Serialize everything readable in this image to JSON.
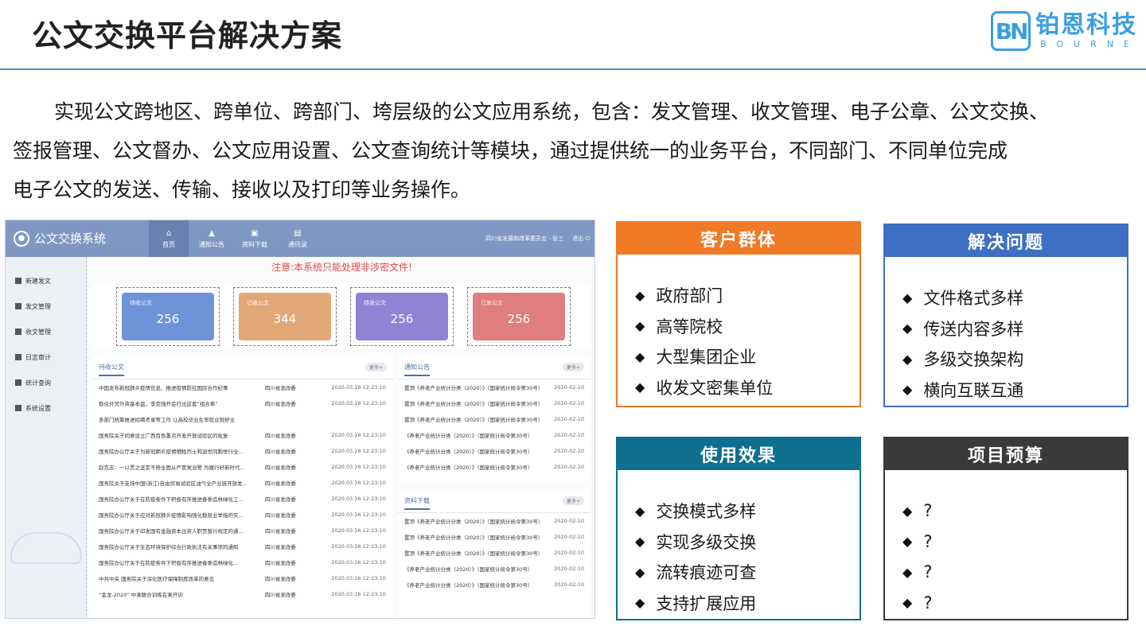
{
  "header": {
    "title": "公文交换平台解决方案",
    "logo_mark": "BN",
    "logo_cn": "铂恩科技",
    "logo_en": "BOURNE"
  },
  "intro": {
    "lines": [
      "实现公文跨地区、跨单位、跨部门、垮层级的公文应用系统，包含：发文管理、收文管理、电子公章、公文交换、",
      "签报管理、公文督办、公文应用设置、公文查询统计等模块，通过提供统一的业务平台，不同部门、不同单位完成",
      "电子公文的发送、传输、接收以及打印等业务操作。"
    ]
  },
  "mock": {
    "app_title": "公文交换系统",
    "nav": [
      {
        "label": "首页",
        "icon": "home-icon"
      },
      {
        "label": "通知公告",
        "icon": "bell-icon"
      },
      {
        "label": "资料下载",
        "icon": "download-icon"
      },
      {
        "label": "通讯录",
        "icon": "contacts-icon"
      }
    ],
    "user": "四川省发展和改革委员会 - 张三",
    "logout": "退出",
    "sidebar": [
      "新建发文",
      "发文管理",
      "收文管理",
      "日志审计",
      "统计查询",
      "系统设置"
    ],
    "notice": "注意:本系统只能处理非涉密文件!",
    "cards": [
      {
        "label": "待收公文",
        "value": "256",
        "color": "#6f93d8"
      },
      {
        "label": "已收公文",
        "value": "344",
        "color": "#e2a777"
      },
      {
        "label": "待发公文",
        "value": "256",
        "color": "#8f83d6"
      },
      {
        "label": "已发公文",
        "value": "256",
        "color": "#e07d7d"
      }
    ],
    "pending": {
      "title": "待收公文",
      "more": "更多+",
      "rows": [
        {
          "t": "中国发布新冠肺炎疫情信息、推进疫情防控国际合作纪事",
          "d": "四川省发改委",
          "tm": "2020.03.16 12:23:10"
        },
        {
          "t": "稳住外贸外资基本盘，李克强开会打出这套“组合拳”",
          "d": "四川省发改委",
          "tm": "2020.03.16 12:23:10"
        },
        {
          "t": "多部门统筹推进招聘考录等工作 让高校毕业生早就业就好业",
          "d": "",
          "tm": ""
        },
        {
          "t": "国务院关于同意设立广西百色重点开发开放试验区的批复",
          "d": "四川省发改委",
          "tm": "2020.03.16 12:23:10"
        },
        {
          "t": "国务院办公厅关于为新冠肺炎疫情牺牲烈士和逝世同胞举行全...",
          "d": "四川省发改委",
          "tm": "2020.03.16 12:23:10"
        },
        {
          "t": "赵克志：一以贯之坚定不移全面从严管党治警 为履行好新时代...",
          "d": "四川省发改委",
          "tm": "2020.03.16 12:23:10"
        },
        {
          "t": "国务院关于支持中国(浙江)自由贸易试验区油气全产业链开放发...",
          "d": "四川省发改委",
          "tm": "2020.03.16 12:23:10"
        },
        {
          "t": "国务院办公厅关于在防疫条件下积极有序推进春季造林绿化工...",
          "d": "四川省发改委",
          "tm": "2020.03.16 12:23:10"
        },
        {
          "t": "国务院办公厅关于应对新冠肺炎疫情影响强化稳就业举措的实...",
          "d": "四川省发改委",
          "tm": "2020.03.16 12:23:10"
        },
        {
          "t": "国务院办公厅关于印发国有金融资本出资人职责暂行规定的通...",
          "d": "四川省发改委",
          "tm": "2020.03.16 12:23:10"
        },
        {
          "t": "国务院办公厅关于生态环境保护综合行政执法有关事项的通知",
          "d": "四川省发改委",
          "tm": "2020.03.16 12:23:10"
        },
        {
          "t": "国务院办公厅关于在防疫条件下积极有序推进春季造林绿化...",
          "d": "四川省发改委",
          "tm": "2020.03.16 12:23:10"
        },
        {
          "t": "中共中央 国务院关于深化医疗保障制度改革的意见",
          "d": "四川省发改委",
          "tm": "2020.03.16 12:23:10"
        },
        {
          "t": "“金龙-2020” 中柬联合训练在柬开训",
          "d": "四川省发改委",
          "tm": "2020.03.16 12:23:10"
        }
      ]
    },
    "announce": {
      "title": "通知公告",
      "more": "更多+",
      "rows": [
        {
          "tag": "置顶",
          "t": "《养老产业统计分类（2020）》（国家统计局令第30号）",
          "tm": "2020-02-10"
        },
        {
          "tag": "置顶",
          "t": "《养老产业统计分类（2020）》（国家统计局令第30号）",
          "tm": "2020-02-10"
        },
        {
          "tag": "置顶",
          "t": "《养老产业统计分类（2020）》（国家统计局令第30号）",
          "tm": "2020-02-10"
        },
        {
          "tag": "",
          "t": "《养老产业统计分类（2020）》（国家统计局令第30号）",
          "tm": "2020-02-10"
        },
        {
          "tag": "",
          "t": "《养老产业统计分类（2020）》（国家统计局令第30号）",
          "tm": "2020-02-10"
        },
        {
          "tag": "",
          "t": "《养老产业统计分类（2020）》（国家统计局令第30号）",
          "tm": "2020-02-10"
        }
      ]
    },
    "downloads": {
      "title": "资料下载",
      "more": "更多+",
      "rows": [
        {
          "tag": "置顶",
          "t": "《养老产业统计分类（2020）》（国家统计局令第30号）",
          "tm": "2020-02-10"
        },
        {
          "tag": "置顶",
          "t": "《养老产业统计分类（2020）》（国家统计局令第30号）",
          "tm": "2020-02-10"
        },
        {
          "tag": "置顶",
          "t": "《养老产业统计分类（2020）》（国家统计局令第30号）",
          "tm": "2020-02-10"
        },
        {
          "tag": "",
          "t": "《养老产业统计分类（2020）》（国家统计局令第30号）",
          "tm": "2020-02-10"
        },
        {
          "tag": "",
          "t": "《养老产业统计分类（2020）》（国家统计局令第30号）",
          "tm": "2020-02-10"
        }
      ]
    }
  },
  "boxes": {
    "customers": {
      "title": "客户群体",
      "color": "#f07a26",
      "items": [
        "政府部门",
        "高等院校",
        "大型集团企业",
        "收发文密集单位"
      ]
    },
    "problems": {
      "title": "解决问题",
      "color": "#3d6fc4",
      "items": [
        "文件格式多样",
        "传送内容多样",
        "多级交换架构",
        "横向互联互通"
      ]
    },
    "effects": {
      "title": "使用效果",
      "color": "#0e6f8e",
      "items": [
        "交换模式多样",
        "实现多级交换",
        "流转痕迹可查",
        "支持扩展应用"
      ]
    },
    "budget": {
      "title": "项目预算",
      "color": "#3a3a3a",
      "items": [
        "?",
        "?",
        "?",
        "?"
      ]
    }
  },
  "bullet": "◆"
}
